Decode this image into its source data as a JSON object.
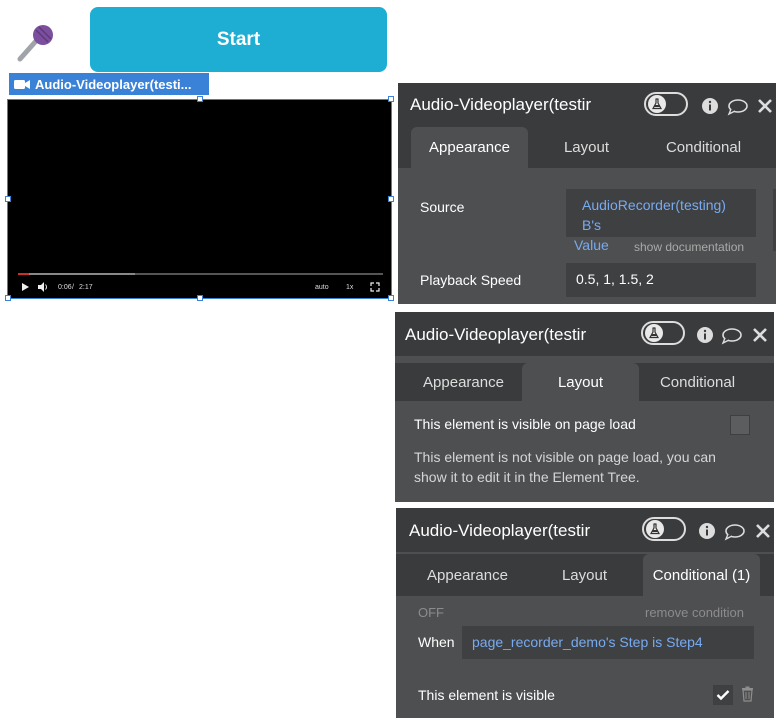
{
  "canvas": {
    "start_button_label": "Start",
    "element_tag_label": "Audio-Videoplayer(testi...",
    "player": {
      "current_time": "0:06",
      "time_separator": "/",
      "duration": "2:17",
      "quality_label": "auto",
      "speed_label": "1x",
      "progress_played": 0.03,
      "progress_buffered": 0.32
    }
  },
  "panel_appearance": {
    "title": "Audio-Videoplayer(testir",
    "tabs": [
      "Appearance",
      "Layout",
      "Conditional"
    ],
    "active_tab": "Appearance",
    "source_label": "Source",
    "source_value_line1": "AudioRecorder(testing) B's",
    "source_value_line2": "Value",
    "show_documentation": "show documentation",
    "playback_speed_label": "Playback Speed",
    "playback_speed_value": "0.5, 1, 1.5, 2"
  },
  "panel_layout": {
    "title": "Audio-Videoplayer(testir",
    "tabs": [
      "Appearance",
      "Layout",
      "Conditional"
    ],
    "active_tab": "Layout",
    "visible_label": "This element is visible on page load",
    "visible_checked": false,
    "info_line1": "This element is not visible on page load, you can",
    "info_line2": "show it to edit it in the Element Tree."
  },
  "panel_conditional": {
    "title": "Audio-Videoplayer(testir",
    "tabs": [
      "Appearance",
      "Layout",
      "Conditional (1)"
    ],
    "active_tab": "Conditional (1)",
    "off_label": "OFF",
    "remove_condition": "remove condition",
    "when_label": "When",
    "when_value": "page_recorder_demo's Step is Step4",
    "visible_label": "This element is visible",
    "visible_checked": true
  },
  "colors": {
    "start_button": "#1eaed3",
    "selection_blue": "#3a82d8",
    "panel_bg": "#4e4f51",
    "panel_header": "#3a3b3d",
    "link_blue": "#78aaf0"
  },
  "icons": [
    "microphone-icon",
    "video-camera-icon",
    "flask-icon",
    "info-icon",
    "comment-icon",
    "close-icon",
    "play-icon",
    "volume-icon",
    "fullscreen-icon",
    "checkmark-icon",
    "trash-icon"
  ]
}
